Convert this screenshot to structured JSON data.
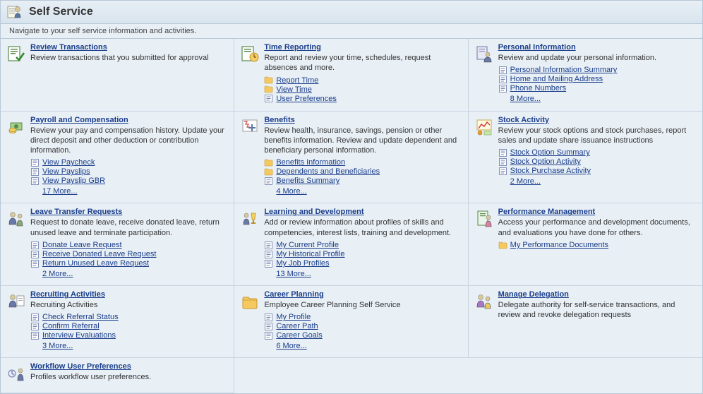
{
  "page": {
    "title": "Self Service",
    "subtitle": "Navigate to your self service information and activities."
  },
  "tiles": [
    [
      {
        "title": "Review Transactions",
        "desc": "Review transactions that you submitted for approval",
        "iconType": "doc-check",
        "links": [],
        "more": ""
      },
      {
        "title": "Time Reporting",
        "desc": "Report and review your time, schedules, request absences and more.",
        "iconType": "clock",
        "links": [
          {
            "label": "Report Time",
            "icon": "folder"
          },
          {
            "label": "View Time",
            "icon": "folder"
          },
          {
            "label": "User Preferences",
            "icon": "page"
          }
        ],
        "more": ""
      },
      {
        "title": "Personal Information",
        "desc": "Review and update your personal information.",
        "iconType": "person-doc",
        "links": [
          {
            "label": "Personal Information Summary",
            "icon": "page"
          },
          {
            "label": "Home and Mailing Address",
            "icon": "page"
          },
          {
            "label": "Phone Numbers",
            "icon": "page"
          }
        ],
        "more": "8 More..."
      }
    ],
    [
      {
        "title": "Payroll and Compensation",
        "desc": "Review your pay and compensation history. Update your direct deposit and other deduction or contribution information.",
        "iconType": "money",
        "links": [
          {
            "label": "View Paycheck",
            "icon": "page"
          },
          {
            "label": "View Payslips",
            "icon": "page"
          },
          {
            "label": "View Payslip GBR",
            "icon": "page"
          }
        ],
        "more": "17 More..."
      },
      {
        "title": "Benefits",
        "desc": "Review health, insurance, savings, pension or other benefits information. Review and update dependent and beneficiary personal information.",
        "iconType": "medical",
        "links": [
          {
            "label": "Benefits Information",
            "icon": "folder"
          },
          {
            "label": "Dependents and Beneficiaries",
            "icon": "folder"
          },
          {
            "label": "Benefits Summary",
            "icon": "page"
          }
        ],
        "more": "4 More..."
      },
      {
        "title": "Stock Activity",
        "desc": "Review your stock options and stock purchases, report sales and update share issuance instructions",
        "iconType": "stock",
        "links": [
          {
            "label": "Stock Option Summary",
            "icon": "page"
          },
          {
            "label": "Stock Option Activity",
            "icon": "page"
          },
          {
            "label": "Stock Purchase Activity",
            "icon": "page"
          }
        ],
        "more": "2 More..."
      }
    ],
    [
      {
        "title": "Leave Transfer Requests",
        "desc": "Request to donate leave, receive donated leave, return unused leave and terminate participation.",
        "iconType": "people",
        "links": [
          {
            "label": "Donate Leave Request",
            "icon": "page"
          },
          {
            "label": "Receive Donated Leave Request",
            "icon": "page"
          },
          {
            "label": "Return Unused Leave Request",
            "icon": "page"
          }
        ],
        "more": "2 More..."
      },
      {
        "title": "Learning and Development",
        "desc": "Add or review information about profiles of skills and competencies, interest lists, training and development.",
        "iconType": "trophy",
        "links": [
          {
            "label": "My Current Profile",
            "icon": "page"
          },
          {
            "label": "My Historical Profile",
            "icon": "page"
          },
          {
            "label": "My Job Profiles",
            "icon": "page"
          }
        ],
        "more": "13 More..."
      },
      {
        "title": "Performance Management",
        "desc": "Access your performance and development documents, and evaluations you have done for others.",
        "iconType": "perf",
        "links": [
          {
            "label": "My Performance Documents",
            "icon": "folder"
          }
        ],
        "more": ""
      }
    ],
    [
      {
        "title": "Recruiting Activities",
        "desc": "Recruiting Activities",
        "iconType": "recruit",
        "links": [
          {
            "label": "Check Referral Status",
            "icon": "page"
          },
          {
            "label": "Confirm Referral",
            "icon": "page"
          },
          {
            "label": "Interview Evaluations",
            "icon": "page"
          }
        ],
        "more": "3 More..."
      },
      {
        "title": "Career Planning",
        "desc": "Employee Career Planning Self Service",
        "iconType": "career",
        "links": [
          {
            "label": "My Profile",
            "icon": "page"
          },
          {
            "label": "Career Path",
            "icon": "page"
          },
          {
            "label": "Career Goals",
            "icon": "page"
          }
        ],
        "more": "6 More..."
      },
      {
        "title": "Manage Delegation",
        "desc": "Delegate authority for self-service transactions, and review and revoke delegation requests",
        "iconType": "delegate",
        "links": [],
        "more": ""
      }
    ],
    [
      {
        "title": "Workflow User Preferences",
        "desc": "Profiles workflow user preferences.",
        "iconType": "workflow",
        "links": [],
        "more": ""
      },
      null,
      null
    ]
  ]
}
